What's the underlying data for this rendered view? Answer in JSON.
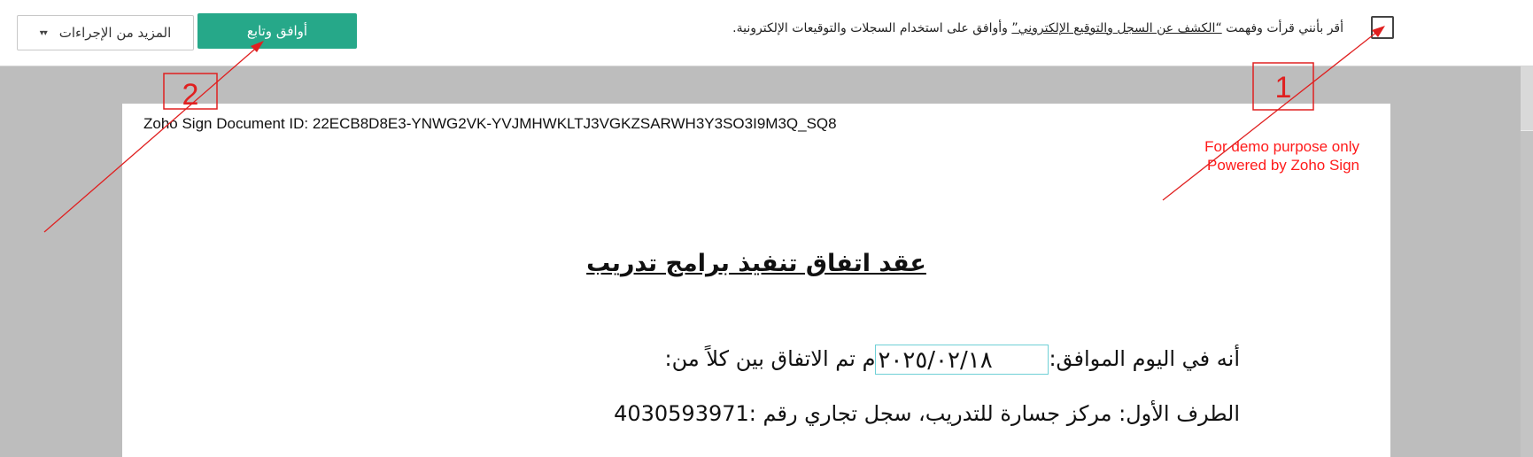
{
  "toolbar": {
    "more_actions_label": "المزيد من الإجراءات",
    "more_actions_icon": "chevron-down-icon",
    "agree_button_label": "أوافق وتابع",
    "consent_prefix": "أقر بأنني قرأت وفهمت ",
    "consent_link": "“الكشف عن السجل والتوقيع الإلكتروني”",
    "consent_suffix": " وأوافق على استخدام السجلات والتوقيعات الإلكترونية."
  },
  "document": {
    "id_line": "Zoho Sign Document ID: 22ECB8D8E3-YNWG2VK-YVJMHWKLTJ3VGKZSARWH3Y3SO3I9M3Q_SQ8",
    "watermark_line1": "For demo purpose only",
    "watermark_line2": "Powered by Zoho Sign",
    "title": "عقد اتفاق تنفيذ برامج تدريب",
    "date_line_before": "أنه في اليوم  الموافق:",
    "date_value": "٢٠٢٥/٠٢/١٨",
    "date_line_after": "م تم الاتفاق بين كلاً من:",
    "party_one": "الطرف الأول: مركز جسارة للتدريب، سجل تجاري رقم :4030593971"
  },
  "annotations": {
    "step1": "1",
    "step2": "2",
    "color": "#e02020"
  },
  "colors": {
    "accent": "#26a889",
    "viewer_bg": "#bdbdbd",
    "date_field_border": "#6fd0d6",
    "watermark": "#ff1a1a"
  }
}
